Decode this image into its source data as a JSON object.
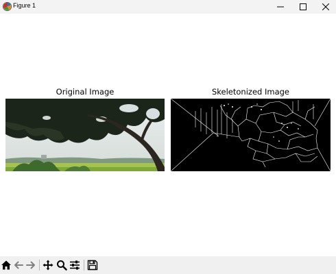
{
  "window": {
    "title": "Figure 1",
    "icon": "matplotlib-icon"
  },
  "window_controls": [
    "minimize-icon",
    "maximize-icon",
    "close-icon"
  ],
  "figure": {
    "subplots": [
      {
        "title": "Original Image",
        "content": "photo of a tree canopy over green fields"
      },
      {
        "title": "Skeletonized Image",
        "content": "white skeleton lines on black background"
      }
    ]
  },
  "toolbar": {
    "buttons": [
      "home-icon",
      "back-arrow-icon",
      "forward-arrow-icon",
      "pan-icon",
      "zoom-icon",
      "configure-subplots-icon",
      "save-icon"
    ]
  },
  "colors": {
    "titlebar": "#f3f3f3",
    "toolbar": "#f0f0f0",
    "canvas": "#ffffff",
    "skeleton_bg": "#000000",
    "skeleton_line": "#ffffff"
  }
}
